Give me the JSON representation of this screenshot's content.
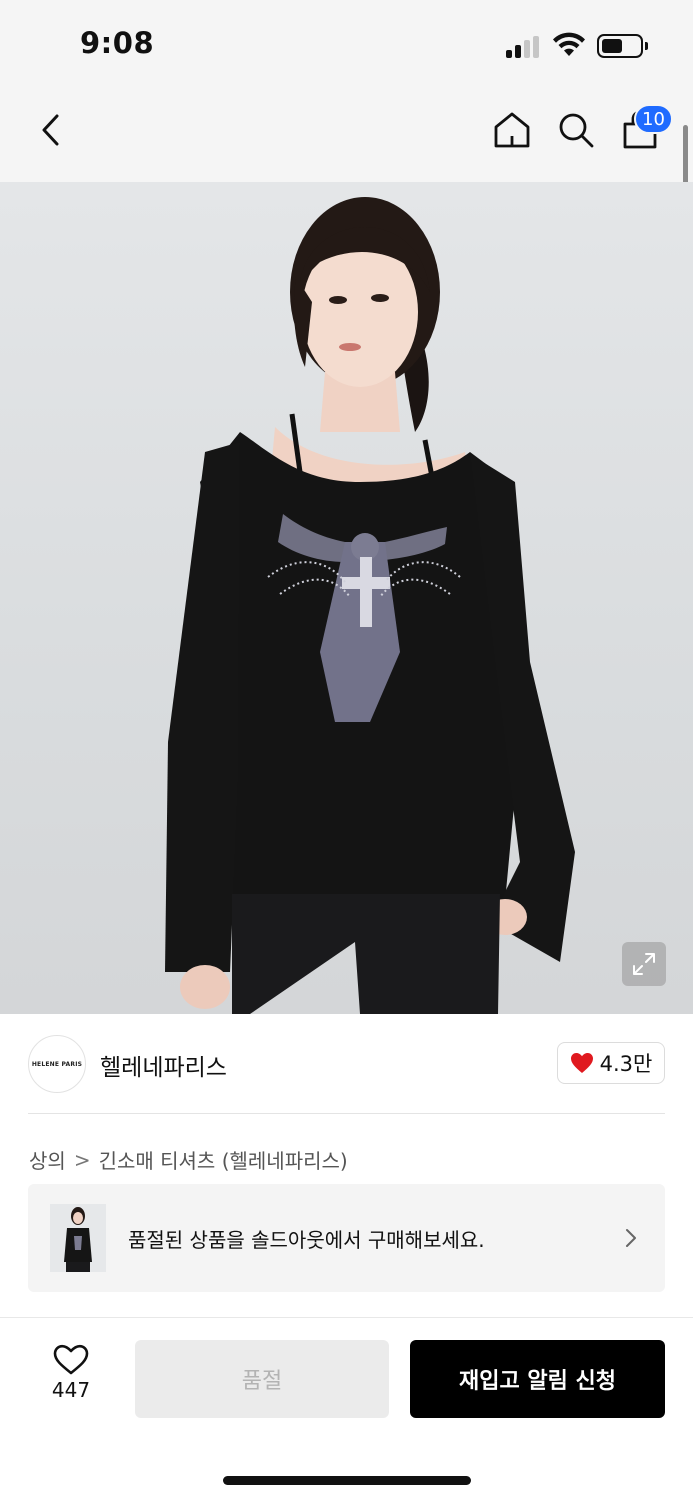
{
  "status_bar": {
    "time": "9:08"
  },
  "nav": {
    "back_icon": "chevron-left-icon",
    "home_icon": "home-icon",
    "search_icon": "search-icon",
    "cart_icon": "shopping-bag-icon",
    "cart_badge": "10",
    "badge_color": "#1f6bff"
  },
  "hero": {
    "expand_icon": "expand-icon"
  },
  "brand": {
    "logo_text": "HELENE PARIS",
    "name": "헬레네파리스",
    "likes": "4.3만",
    "heart_color": "#e0191f"
  },
  "breadcrumb": {
    "items": [
      "상의",
      "긴소매 티셔츠 (헬레네파리스)"
    ],
    "separator": ">"
  },
  "banner": {
    "text": "품절된 상품을 솔드아웃에서 구매해보세요."
  },
  "bottom_bar": {
    "wish_count": "447",
    "soldout_label": "품절",
    "restock_label": "재입고 알림 신청"
  }
}
